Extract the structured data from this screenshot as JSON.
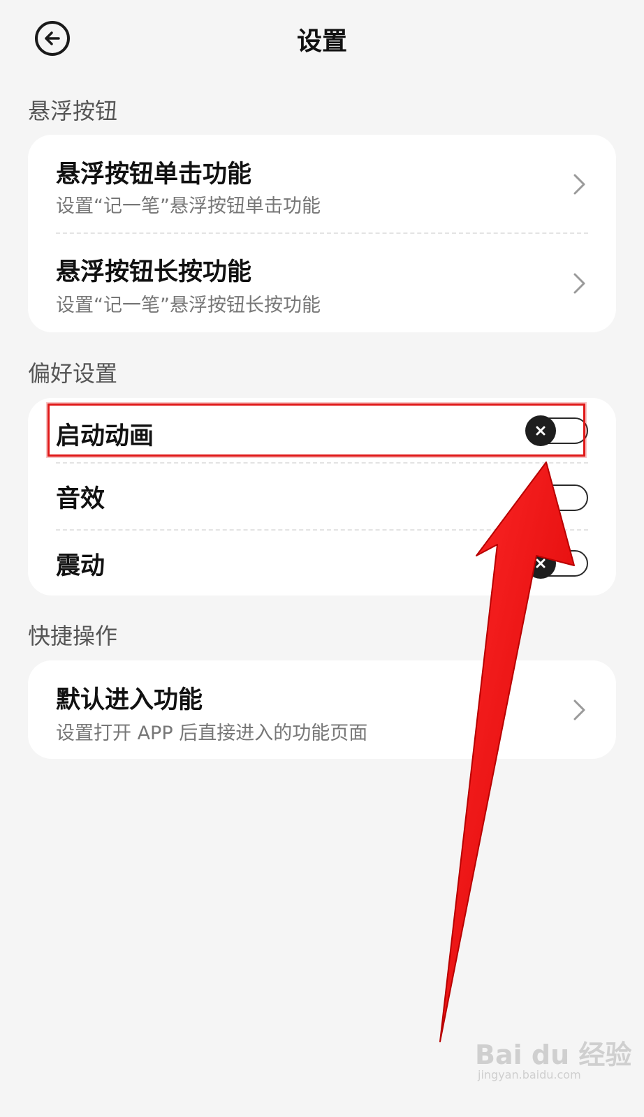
{
  "header": {
    "title": "设置",
    "back_icon": "back-arrow-icon"
  },
  "sections": {
    "floating": {
      "title": "悬浮按钮",
      "items": [
        {
          "title": "悬浮按钮单击功能",
          "subtitle": "设置“记一笔”悬浮按钮单击功能"
        },
        {
          "title": "悬浮按钮长按功能",
          "subtitle": "设置“记一笔”悬浮按钮长按功能"
        }
      ]
    },
    "preferences": {
      "title": "偏好设置",
      "items": [
        {
          "title": "启动动画",
          "toggle": "off"
        },
        {
          "title": "音效",
          "toggle": "off"
        },
        {
          "title": "震动",
          "toggle": "off"
        }
      ]
    },
    "shortcuts": {
      "title": "快捷操作",
      "items": [
        {
          "title": "默认进入功能",
          "subtitle": "设置打开 APP 后直接进入的功能页面"
        }
      ]
    }
  },
  "annotation": {
    "highlight_color": "#e01818",
    "arrow_color": "#ee1111"
  },
  "watermark": {
    "logo": "Bai du 经验",
    "url": "jingyan.baidu.com"
  },
  "colors": {
    "background": "#f5f5f5",
    "card": "#ffffff",
    "toggle_knob": "#1e1e1e"
  }
}
